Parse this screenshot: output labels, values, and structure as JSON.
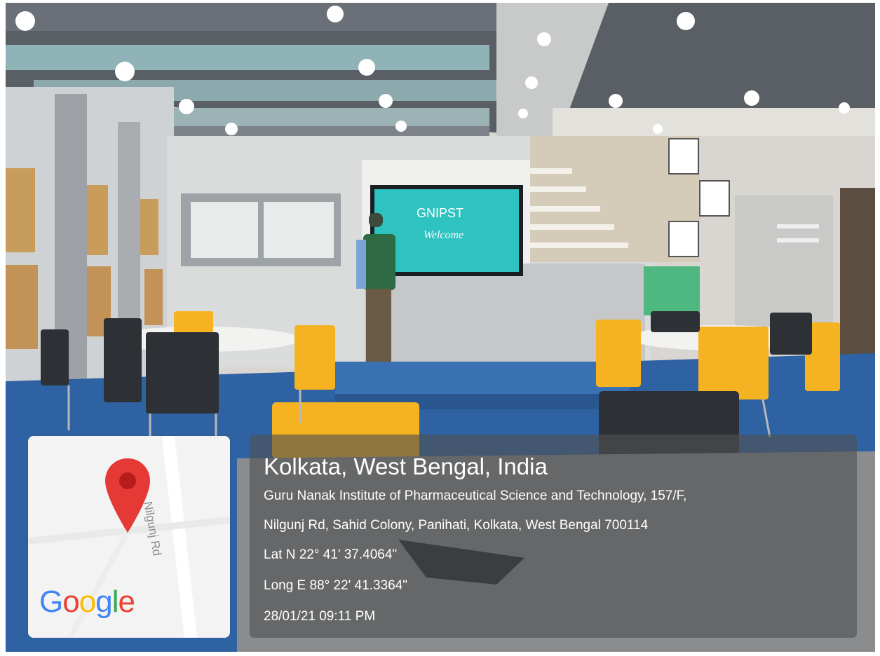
{
  "overlay": {
    "title": "Kolkata, West Bengal, India",
    "address_line1": "Guru Nanak Institute of Pharmaceutical Science and Technology, 157/F,",
    "address_line2": "Nilgunj Rd, Sahid Colony, Panihati, Kolkata, West Bengal 700114",
    "latitude": "Lat N 22° 41' 37.4064\"",
    "longitude": "Long E 88° 22' 41.3364\"",
    "timestamp": "28/01/21 09:11 PM"
  },
  "map": {
    "road_label": "Nilgunj Rd",
    "logo": [
      "G",
      "o",
      "o",
      "g",
      "l",
      "e"
    ],
    "logo_colors": [
      "#4285F4",
      "#EA4335",
      "#FBBC05",
      "#4285F4",
      "#34A853",
      "#EA4335"
    ],
    "pin_color": "#E53935",
    "icon": "map-pin-icon"
  },
  "photo": {
    "screen_text": "GNIPST",
    "screen_subtext": "Welcome"
  }
}
